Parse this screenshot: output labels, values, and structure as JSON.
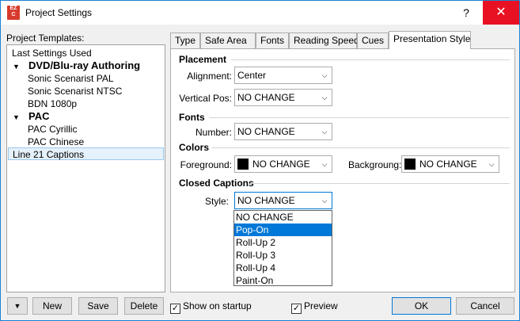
{
  "window": {
    "title": "Project Settings",
    "app_icon_top": "EZ",
    "app_icon_bottom": "C",
    "help_label": "?",
    "close_label": "✕"
  },
  "templates": {
    "label": "Project Templates:",
    "items": [
      {
        "label": "Last Settings Used"
      },
      {
        "label": "DVD/Blu-ray Authoring",
        "arrow": "▼"
      },
      {
        "label": "Sonic Scenarist PAL"
      },
      {
        "label": "Sonic Scenarist NTSC"
      },
      {
        "label": "BDN 1080p"
      },
      {
        "label": "PAC",
        "arrow": "▼"
      },
      {
        "label": "PAC Cyrillic"
      },
      {
        "label": "PAC Chinese"
      },
      {
        "label": "Line 21 Captions"
      }
    ]
  },
  "tabs": [
    "Type",
    "Safe Area",
    "Fonts",
    "Reading Speed",
    "Cues",
    "Presentation Style"
  ],
  "placement": {
    "heading": "Placement",
    "alignment_label": "Alignment:",
    "alignment_value": "Center",
    "vertical_label": "Vertical Pos:",
    "vertical_value": "NO CHANGE"
  },
  "fonts": {
    "heading": "Fonts",
    "number_label": "Number:",
    "number_value": "NO CHANGE"
  },
  "colors": {
    "heading": "Colors",
    "foreground_label": "Foreground:",
    "foreground_value": "NO CHANGE",
    "background_label": "Backgroung:",
    "background_value": "NO CHANGE",
    "swatch_color": "#000000"
  },
  "closed_captions": {
    "heading": "Closed Captions",
    "style_label": "Style:",
    "style_value": "NO CHANGE",
    "options": [
      "NO CHANGE",
      "Pop-On",
      "Roll-Up 2",
      "Roll-Up 3",
      "Roll-Up 4",
      "Paint-On"
    ],
    "highlighted": "Pop-On"
  },
  "bottom": {
    "menu_arrow": "▼",
    "new_label": "New",
    "save_label": "Save",
    "delete_label": "Delete",
    "show_on_startup_label": "Show on startup",
    "show_on_startup_checked": true,
    "preview_label": "Preview",
    "preview_checked": true,
    "ok_label": "OK",
    "cancel_label": "Cancel"
  },
  "colors_theme": {
    "accent": "#0078d7",
    "close": "#e81123"
  }
}
